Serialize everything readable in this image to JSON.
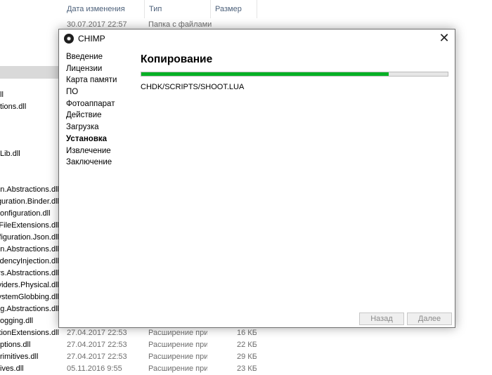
{
  "explorer": {
    "columns": {
      "date": "Дата изменения",
      "type": "Тип",
      "size": "Размер"
    },
    "top_row": {
      "date": "30.07.2017 22:57",
      "type": "Папка с файлами"
    },
    "files": [
      "ll",
      "tions.dll",
      "Lib.dll",
      "onfiguration.Abstractions.dll",
      "onfiguration.Binder.dll",
      "onfiguration.dll",
      "onfiguration.FileExtensions.dll",
      "onfiguration.Json.dll",
      "ependencyInjection.Abstractions.dll",
      "ependencyInjection.dll",
      "leProviders.Abstractions.dll",
      "leProviders.Physical.dll",
      "leSystemGlobbing.dll",
      "ogging.Abstractions.dll",
      "ogging.dll",
      "ptions.ConfigurationExtensions.dll",
      "ptions.dll",
      "rimitives.dll",
      "ives.dll"
    ],
    "bottom_rows": [
      {
        "date": "27.04.2017 22:53",
        "type": "Расширение приложения",
        "size": "16 КБ"
      },
      {
        "date": "27.04.2017 22:53",
        "type": "Расширение приложения",
        "size": "22 КБ"
      },
      {
        "date": "27.04.2017 22:53",
        "type": "Расширение приложения",
        "size": "29 КБ"
      },
      {
        "date": "05.11.2016 9:55",
        "type": "Расширение приложения",
        "size": "23 КБ"
      }
    ]
  },
  "dialog": {
    "title": "CHIMP",
    "close_glyph": "✕",
    "nav": [
      "Введение",
      "Лицензии",
      "Карта памяти",
      "ПО",
      "Фотоаппарат",
      "Действие",
      "Загрузка",
      "Установка",
      "Извлечение",
      "Заключение"
    ],
    "active_index": 7,
    "heading": "Копирование",
    "progress": 0.807,
    "progress_color": "#06b025",
    "current_file": "CHDK/SCRIPTS/SHOOT.LUA",
    "buttons": {
      "back": "Назад",
      "next": "Далее"
    }
  }
}
